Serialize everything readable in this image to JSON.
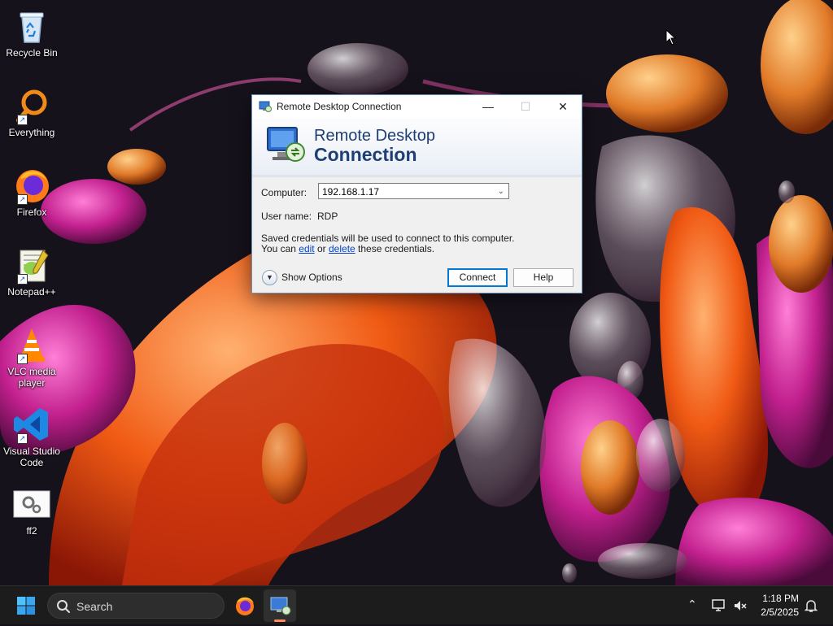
{
  "desktop": {
    "icons": [
      {
        "label": "Recycle Bin",
        "icon": "recycle-bin-icon"
      },
      {
        "label": "Everything",
        "icon": "everything-search-icon"
      },
      {
        "label": "Firefox",
        "icon": "firefox-icon"
      },
      {
        "label": "Notepad++",
        "icon": "notepad-plus-plus-icon"
      },
      {
        "label": "VLC media player",
        "icon": "vlc-icon"
      },
      {
        "label": "Visual Studio Code",
        "icon": "vscode-icon"
      },
      {
        "label": "ff2",
        "icon": "settings-file-icon"
      }
    ]
  },
  "dialog": {
    "title": "Remote Desktop Connection",
    "banner_line1": "Remote Desktop",
    "banner_line2": "Connection",
    "computer_label": "Computer:",
    "computer_value": "192.168.1.17",
    "username_label": "User name:",
    "username_value": "RDP",
    "credentials_line1": "Saved credentials will be used to connect to this computer.",
    "credentials_you_can": "You can",
    "edit_link": "edit",
    "or_text": "or",
    "delete_link": "delete",
    "credentials_tail": "these credentials.",
    "show_options_label": "Show Options",
    "connect_label": "Connect",
    "help_label": "Help"
  },
  "taskbar": {
    "search_placeholder": "Search",
    "time": "1:18 PM",
    "date": "2/5/2025"
  },
  "colors": {
    "accent": "#0078d4",
    "banner_text": "#1e3f73",
    "link": "#0645c5"
  }
}
